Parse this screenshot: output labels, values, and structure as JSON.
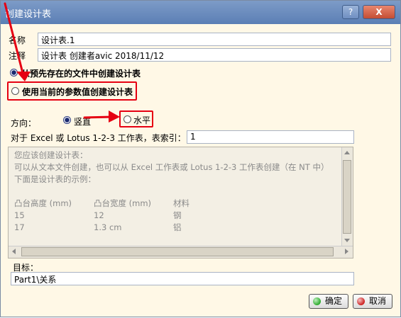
{
  "window": {
    "title": "创建设计表",
    "help": "?",
    "close": "X"
  },
  "form": {
    "name_label": "名称",
    "name_value": "设计表.1",
    "comment_label": "注释",
    "comment_value": "设计表 创建者avic 2018/11/12"
  },
  "options": {
    "from_file": "从预先存在的文件中创建设计表",
    "from_current": "使用当前的参数值创建设计表"
  },
  "orientation": {
    "label": "方向：",
    "vertical": "竖直",
    "horizontal": "水平"
  },
  "sheet_index": {
    "label": "对于 Excel 或 Lotus 1-2-3 工作表，表索引：",
    "value": "1"
  },
  "info": {
    "lines": [
      "您应该创建设计表：",
      "可以从文本文件创建，也可以从 Excel 工作表或 Lotus 1-2-3 工作表创建（在 NT 中）",
      "下面是设计表的示例："
    ],
    "table": {
      "headers": [
        "凸台高度 (mm)",
        "凸台宽度 (mm)",
        "材料"
      ],
      "rows": [
        [
          "15",
          "12",
          "钢"
        ],
        [
          "17",
          "1.3 cm",
          "铝"
        ]
      ]
    }
  },
  "target": {
    "label": "目标：",
    "value": "Part1\\关系"
  },
  "buttons": {
    "ok": "确定",
    "cancel": "取消"
  },
  "colors": {
    "annotation_red": "#e60012",
    "ok_green": "#2eaa2e",
    "cancel_red": "#cc2222"
  }
}
